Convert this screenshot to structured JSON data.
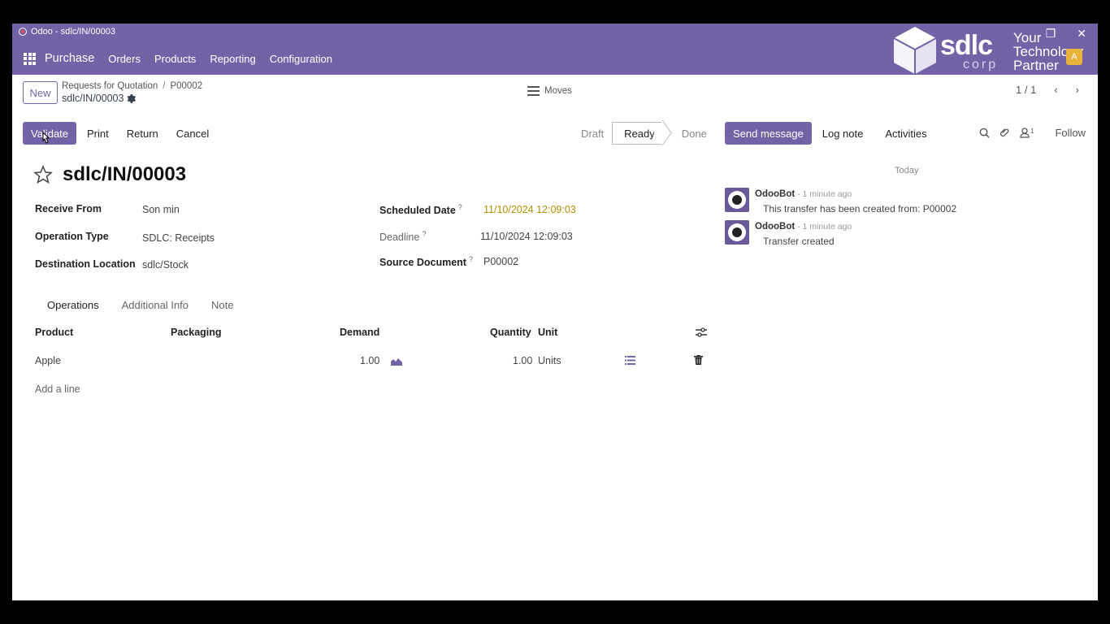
{
  "window": {
    "title": "Odoo - sdlc/IN/00003"
  },
  "nav": {
    "app": "Purchase",
    "items": [
      "Orders",
      "Products",
      "Reporting",
      "Configuration"
    ]
  },
  "brand": {
    "logo_text": "sdlc",
    "tag1": "Your",
    "tag2": "Technology",
    "tag3": "Partner",
    "corp": "corp",
    "user": "A"
  },
  "breadcrumb": {
    "new_label": "New",
    "parent": "Requests for Quotation",
    "sep": "/",
    "current": "P00002",
    "record": "sdlc/IN/00003"
  },
  "moves": {
    "label": "Moves"
  },
  "pager": {
    "value": "1 / 1"
  },
  "actions": {
    "validate": "Validate",
    "print": "Print",
    "return": "Return",
    "cancel": "Cancel"
  },
  "status": {
    "draft": "Draft",
    "ready": "Ready",
    "done": "Done"
  },
  "chatter": {
    "send": "Send message",
    "log": "Log note",
    "activities": "Activities",
    "followers_count": "1",
    "follow": "Follow",
    "day": "Today",
    "messages": [
      {
        "author": "OdooBot",
        "time": " - 1 minute ago",
        "body": "This transfer has been created from: P00002"
      },
      {
        "author": "OdooBot",
        "time": " - 1 minute ago",
        "body": "Transfer created"
      }
    ]
  },
  "record": {
    "title": "sdlc/IN/00003"
  },
  "fields": {
    "receive_from": {
      "label": "Receive From",
      "value": "Son min"
    },
    "operation_type": {
      "label": "Operation Type",
      "value": "SDLC: Receipts"
    },
    "destination": {
      "label": "Destination Location",
      "value": "sdlc/Stock"
    },
    "scheduled": {
      "label": "Scheduled Date",
      "help": "?",
      "value": "11/10/2024 12:09:03"
    },
    "deadline": {
      "label": "Deadline",
      "help": "?",
      "value": "11/10/2024 12:09:03"
    },
    "source": {
      "label": "Source Document",
      "help": "?",
      "value": "P00002"
    }
  },
  "tabs": [
    "Operations",
    "Additional Info",
    "Note"
  ],
  "table": {
    "headers": {
      "product": "Product",
      "packaging": "Packaging",
      "demand": "Demand",
      "quantity": "Quantity",
      "unit": "Unit"
    },
    "rows": [
      {
        "product": "Apple",
        "demand": "1.00",
        "quantity": "1.00",
        "unit": "Units"
      }
    ],
    "add_line": "Add a line"
  },
  "colors": {
    "primary": "#7462a7",
    "scheduled_date": "#b38f00"
  }
}
